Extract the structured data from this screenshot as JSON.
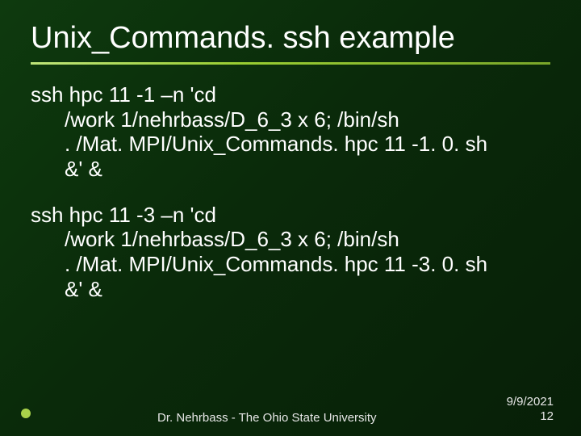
{
  "slide": {
    "title": "Unix_Commands. ssh example",
    "commands": [
      {
        "first": "ssh hpc 11 -1 –n 'cd",
        "cont": [
          "/work 1/nehrbass/D_6_3 x 6; /bin/sh",
          ". /Mat. MPI/Unix_Commands. hpc 11 -1. 0. sh",
          "&' &"
        ]
      },
      {
        "first": "ssh hpc 11 -3 –n 'cd",
        "cont": [
          "/work 1/nehrbass/D_6_3 x 6; /bin/sh",
          ". /Mat. MPI/Unix_Commands. hpc 11 -3. 0. sh",
          "&' &"
        ]
      }
    ],
    "footer": {
      "center": "Dr. Nehrbass - The Ohio State University",
      "date": "9/9/2021",
      "page": "12"
    }
  }
}
